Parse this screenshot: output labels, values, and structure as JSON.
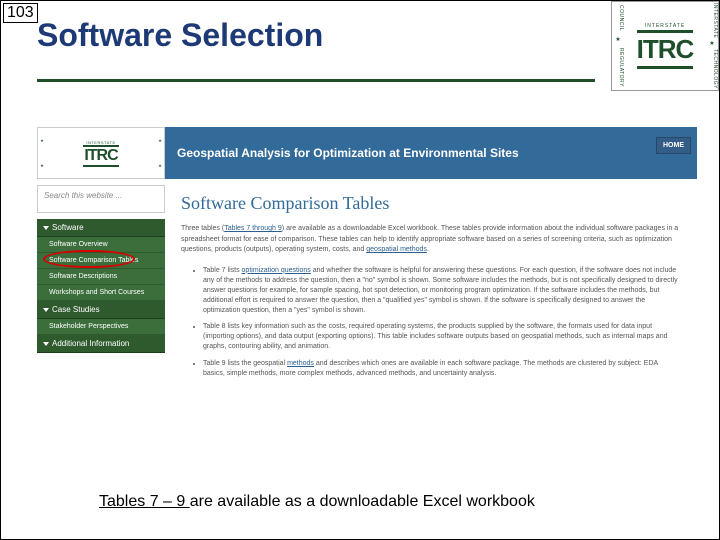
{
  "page_number": "103",
  "title": "Software Selection",
  "corner_logo": {
    "top_left": "COUNCIL",
    "top_right": "INTERSTATE",
    "bottom_left": "REGULATORY",
    "bottom_right": "TECHNOLOGY",
    "interstate_label": "INTERSTATE",
    "itrc_text": "ITRC"
  },
  "sidebar": {
    "mini_logo": {
      "interstate_label": "INTERSTATE",
      "itrc_text": "ITRC"
    },
    "search_placeholder": "Search this website ...",
    "items": [
      {
        "label": "Software",
        "type": "section"
      },
      {
        "label": "Software Overview",
        "type": "sub"
      },
      {
        "label": "Software Comparison Tables",
        "type": "sub",
        "active": true
      },
      {
        "label": "Software Descriptions",
        "type": "sub"
      },
      {
        "label": "Workshops and Short Courses",
        "type": "sub"
      },
      {
        "label": "Case Studies",
        "type": "section"
      },
      {
        "label": "Stakeholder Perspectives",
        "type": "sub"
      },
      {
        "label": "Additional Information",
        "type": "section"
      }
    ]
  },
  "main": {
    "banner_title": "Geospatial Analysis for Optimization at Environmental Sites",
    "home_label": "HOME",
    "heading": "Software Comparison Tables",
    "intro_parts": {
      "p1a": "Three tables (",
      "p1_link": "Tables 7 through 9",
      "p1b": ") are available as a downloadable Excel workbook. These tables provide information about the individual software packages in a spreadsheet format for ease of comparison. These tables can help to identify appropriate software based on a series of screening criteria, such as optimization questions, products (outputs), operating system, costs, and ",
      "p1_link2": "geospatial methods",
      "p1c": "."
    },
    "bullets": [
      {
        "pre": "Table 7 lists ",
        "link": "optimization questions",
        "post": " and whether the software is helpful for answering these questions. For each question, if the software does not include any of the methods to address the question, then a \"no\" symbol is shown. Some software includes the methods, but is not specifically designed to directly answer questions for example, for sample spacing, hot spot detection, or monitoring program optimization. If the software includes the methods, but additional effort is required to answer the question, then a \"qualified yes\" symbol is shown. If the software is specifically designed to answer the optimization question, then a \"yes\" symbol is shown."
      },
      {
        "pre": "Table 8 lists key information such as the costs, required operating systems, the products supplied by the software, the formats used for data input (importing options), and data output (exporting options). This table includes software outputs based on geospatial methods, such as internal maps and graphs, contouring ability, and animation.",
        "link": "",
        "post": ""
      },
      {
        "pre": "Table 9 lists the geospatial ",
        "link": "methods",
        "post": " and describes which ones are available in each software package. The methods are clustered by subject: EDA basics, simple methods, more complex methods, advanced methods, and uncertainty analysis."
      }
    ]
  },
  "footer": {
    "link_text": "Tables 7 – 9 ",
    "rest": "are available as a downloadable Excel workbook"
  }
}
